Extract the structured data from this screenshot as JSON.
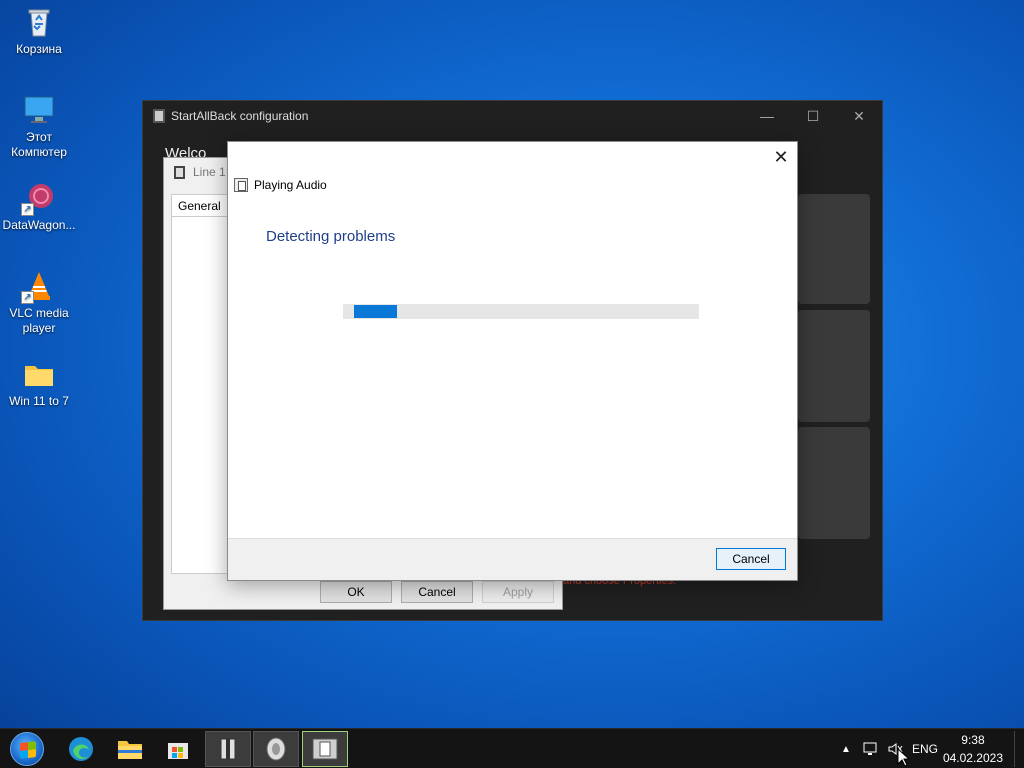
{
  "desktop": {
    "icons": [
      {
        "label": "Корзина",
        "icon": "recycle-bin-icon"
      },
      {
        "label": "Этот Компютер",
        "icon": "computer-icon"
      },
      {
        "label": "DataWagon...",
        "icon": "datawagon-icon"
      },
      {
        "label": "VLC media player",
        "icon": "vlc-icon"
      },
      {
        "label": "Win 11 to 7",
        "icon": "folder-icon"
      }
    ]
  },
  "sab_window": {
    "title": "StartAllBack configuration",
    "welcome": "Welco",
    "red_text": "and choose Properties."
  },
  "properties_dialog": {
    "title": "Line 1",
    "tab": "General",
    "buttons": {
      "ok": "OK",
      "cancel": "Cancel",
      "apply": "Apply"
    }
  },
  "troubleshooter": {
    "header": "Playing Audio",
    "heading": "Detecting problems",
    "progress_fraction": 0.12,
    "cancel": "Cancel"
  },
  "taskbar": {
    "language": "ENG",
    "time": "9:38",
    "date": "04.02.2023"
  },
  "colors": {
    "accent": "#0a78d7",
    "heading": "#1e3f8a",
    "desktop": "#1270d8",
    "taskbar": "#141414"
  }
}
